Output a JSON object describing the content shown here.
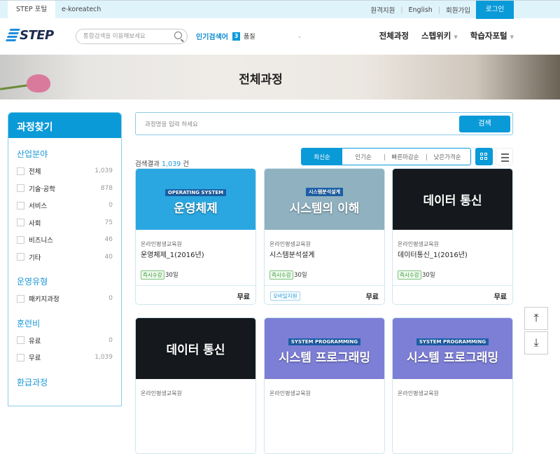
{
  "topbar": {
    "tabs": [
      "STEP 포털",
      "e-koreatech"
    ],
    "links": [
      "원격지원",
      "English",
      "회원가입"
    ],
    "login": "로그인"
  },
  "header": {
    "logo": "STEP",
    "search_placeholder": "통합검색을 이용해보세요",
    "popular_label": "인기검색어",
    "popular_rank": "3",
    "popular_keyword": "품질",
    "nav": [
      "전체과정",
      "스텝위키",
      "학습자포털"
    ]
  },
  "banner": {
    "title": "전체과정"
  },
  "sidebar": {
    "title": "과정찾기",
    "groups": [
      {
        "title": "산업분야",
        "items": [
          {
            "label": "전체",
            "count": "1,039"
          },
          {
            "label": "기술·공학",
            "count": "878"
          },
          {
            "label": "서비스",
            "count": "0"
          },
          {
            "label": "사회",
            "count": "75"
          },
          {
            "label": "비즈니스",
            "count": "46"
          },
          {
            "label": "기타",
            "count": "40"
          }
        ]
      },
      {
        "title": "운영유형",
        "items": [
          {
            "label": "패키지과정",
            "count": "0"
          }
        ]
      },
      {
        "title": "훈련비",
        "items": [
          {
            "label": "유료",
            "count": "0"
          },
          {
            "label": "무료",
            "count": "1,039"
          }
        ]
      },
      {
        "title": "환급과정",
        "items": []
      }
    ]
  },
  "search": {
    "placeholder": "과정명을 입력 하세요",
    "button": "검색"
  },
  "results": {
    "prefix": "검색결과",
    "count": "1,039",
    "suffix": "건"
  },
  "sort": {
    "options": [
      "최신순",
      "인기순",
      "빠른마감순",
      "낮은가격순"
    ],
    "active": "최신순"
  },
  "cards": [
    {
      "image_text": "운영체제",
      "image_sub": "OPERATING SYSTEM",
      "bg": "#2aa7e0",
      "org": "온라인평생교육원",
      "title": "운영체제_1(2016년)",
      "badge": "즉시수강",
      "days": "30일",
      "mobile": "",
      "price": "무료"
    },
    {
      "image_text": "시스템의 이해",
      "image_sub": "시스템분석설계",
      "bg": "#8fb1c0",
      "org": "온라인평생교육원",
      "title": "시스템분석설계",
      "badge": "즉시수강",
      "days": "30일",
      "mobile": "모바일지원",
      "price": "무료"
    },
    {
      "image_text": "데이터 통신",
      "image_sub": "",
      "bg": "#15191d",
      "org": "온라인평생교육원",
      "title": "데이터통신_1(2016년)",
      "badge": "즉시수강",
      "days": "30일",
      "mobile": "",
      "price": "무료"
    },
    {
      "image_text": "데이터 통신",
      "image_sub": "",
      "bg": "#15191d",
      "org": "온라인평생교육원",
      "title": "",
      "badge": "",
      "days": "",
      "mobile": "",
      "price": ""
    },
    {
      "image_text": "시스템 프로그래밍",
      "image_sub": "SYSTEM PROGRAMMING",
      "bg": "#7d7fd6",
      "org": "온라인평생교육원",
      "title": "",
      "badge": "",
      "days": "",
      "mobile": "",
      "price": ""
    },
    {
      "image_text": "시스템 프로그래밍",
      "image_sub": "SYSTEM PROGRAMMING",
      "bg": "#7d7fd6",
      "org": "온라인평생교육원",
      "title": "",
      "badge": "",
      "days": "",
      "mobile": "",
      "price": ""
    }
  ],
  "float": {
    "top": "⤒",
    "bottom": "⤓"
  }
}
